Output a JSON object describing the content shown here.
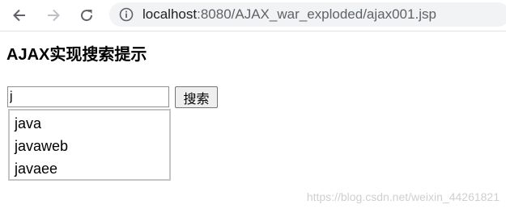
{
  "browser": {
    "url_host": "localhost",
    "url_rest": ":8080/AJAX_war_exploded/ajax001.jsp"
  },
  "page": {
    "title": "AJAX实现搜索提示",
    "search_value": "j",
    "search_button_label": "搜索",
    "suggestions": [
      "java",
      "javaweb",
      "javaee"
    ]
  },
  "watermark": "https://blog.csdn.net/weixin_44261821",
  "icons": {
    "back": "arrow-left-icon",
    "forward": "arrow-right-icon",
    "reload": "reload-icon",
    "info": "info-icon"
  },
  "colors": {
    "toolbar_icon": "#5f6368",
    "forward_disabled": "#bdc1c6",
    "address_bg": "#f1f3f4"
  }
}
